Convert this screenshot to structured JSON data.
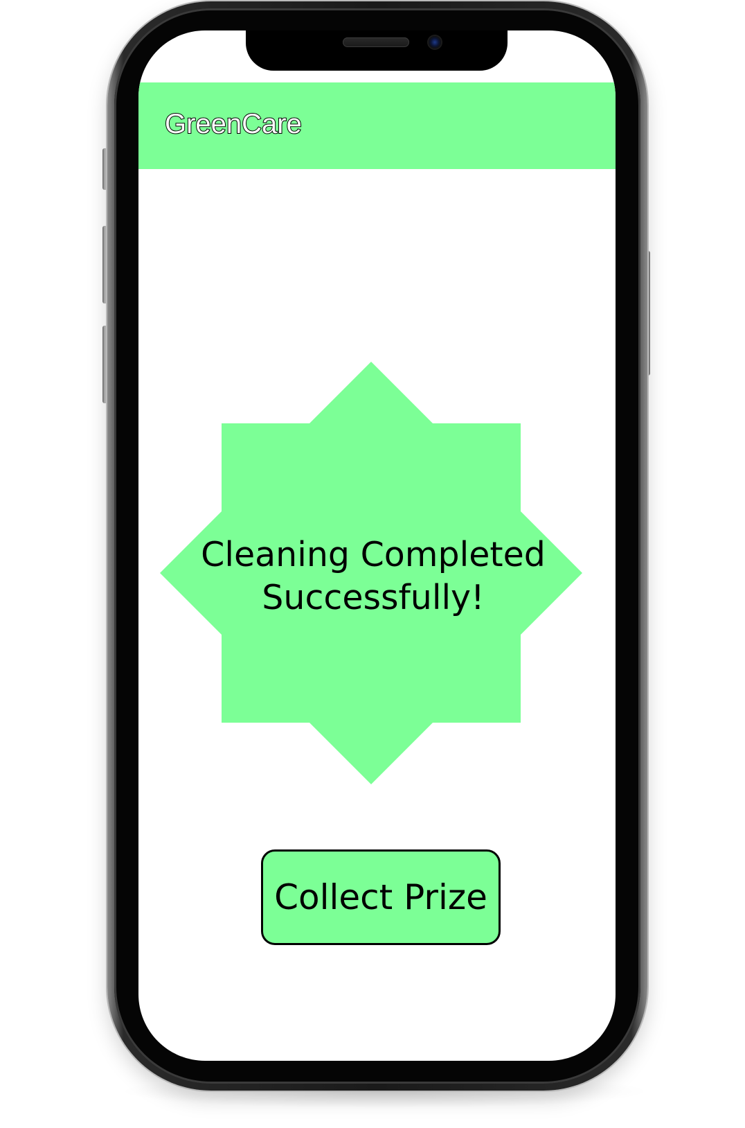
{
  "app": {
    "title": "GreenCare"
  },
  "content": {
    "message_line1": "Cleaning Completed",
    "message_line2": "Successfully!",
    "badge_shape": "eight-point-star",
    "badge_color": "#7cff96"
  },
  "actions": {
    "collect_label": "Collect Prize"
  },
  "colors": {
    "accent": "#7cff96",
    "text": "#000000",
    "background": "#ffffff"
  }
}
